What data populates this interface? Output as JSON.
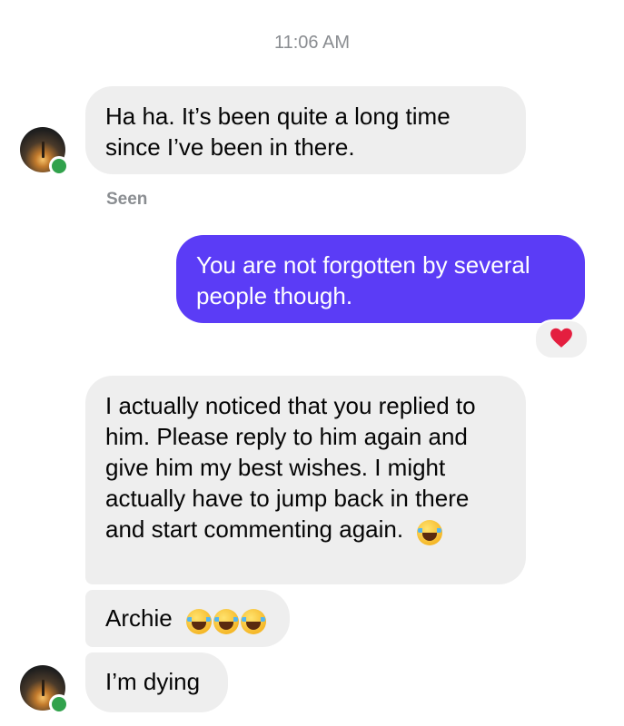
{
  "timestamp": "11:06 AM",
  "messages": [
    {
      "direction": "incoming",
      "text": "Ha ha. It’s been quite a long time since I’ve been in there."
    },
    {
      "direction": "outgoing",
      "text": "You are not forgotten by several people though."
    },
    {
      "direction": "incoming",
      "text": "I actually noticed that you replied to him. Please reply to him again and give him my best wishes. I might actually have to jump back in there and start commenting again.",
      "emoji": "face-with-tears-of-joy"
    },
    {
      "direction": "incoming",
      "text": "Archie",
      "emoji_count": 3
    },
    {
      "direction": "incoming",
      "text": "I’m dying"
    }
  ],
  "seen_label": "Seen",
  "reaction": {
    "icon": "heart-icon",
    "emoji": "❤️",
    "color": "#e41e3f"
  },
  "colors": {
    "outgoing_bubble": "#5b3cf6",
    "incoming_bubble": "#eeeeee",
    "online_dot": "#31a24c"
  }
}
